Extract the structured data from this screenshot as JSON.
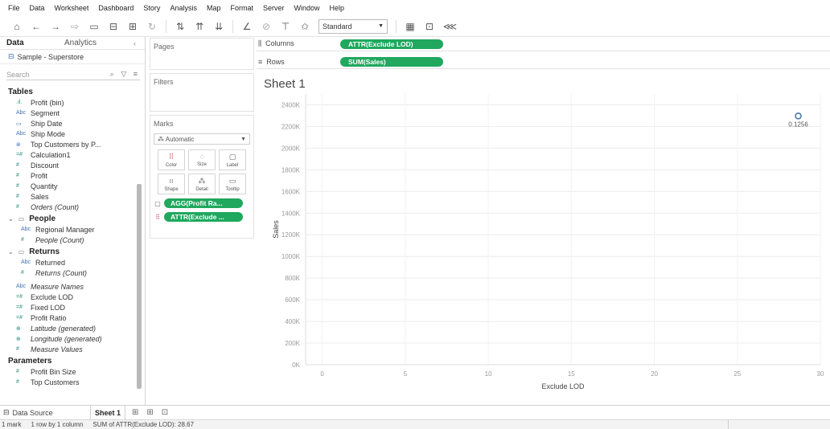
{
  "menu": [
    "File",
    "Data",
    "Worksheet",
    "Dashboard",
    "Story",
    "Analysis",
    "Map",
    "Format",
    "Server",
    "Window",
    "Help"
  ],
  "toolbar": {
    "fit_select": "Standard"
  },
  "data_pane": {
    "tab_data": "Data",
    "tab_analytics": "Analytics",
    "collapse_glyph": "‹",
    "source": "Sample - Superstore",
    "search_placeholder": "Search",
    "sections": {
      "tables": {
        "title": "Tables",
        "fields": [
          {
            "icon": ".ıl.",
            "label": "Profit (bin)",
            "italic": false
          },
          {
            "icon": "Abc",
            "label": "Segment",
            "italic": false
          },
          {
            "icon": "▭",
            "label": "Ship Date",
            "italic": false
          },
          {
            "icon": "Abc",
            "label": "Ship Mode",
            "italic": false
          },
          {
            "icon": "⊛",
            "label": "Top Customers by P...",
            "italic": false
          },
          {
            "icon": "=#",
            "label": "Calculation1",
            "italic": false
          },
          {
            "icon": "#",
            "label": "Discount",
            "italic": false
          },
          {
            "icon": "#",
            "label": "Profit",
            "italic": false
          },
          {
            "icon": "#",
            "label": "Quantity",
            "italic": false
          },
          {
            "icon": "#",
            "label": "Sales",
            "italic": false
          },
          {
            "icon": "#",
            "label": "Orders (Count)",
            "italic": true
          }
        ]
      },
      "people": {
        "title": "People",
        "fields": [
          {
            "icon": "Abc",
            "label": "Regional Manager",
            "italic": false
          },
          {
            "icon": "#",
            "label": "People (Count)",
            "italic": true
          }
        ]
      },
      "returns": {
        "title": "Returns",
        "fields": [
          {
            "icon": "Abc",
            "label": "Returned",
            "italic": false
          },
          {
            "icon": "#",
            "label": "Returns (Count)",
            "italic": true
          }
        ]
      },
      "loose": [
        {
          "icon": "Abc",
          "label": "Measure Names",
          "italic": true
        },
        {
          "icon": "=#",
          "label": "Exclude LOD",
          "italic": false
        },
        {
          "icon": "=#",
          "label": "Fixed LOD",
          "italic": false
        },
        {
          "icon": "=#",
          "label": "Profit Ratio",
          "italic": false
        },
        {
          "icon": "⊕",
          "label": "Latitude (generated)",
          "italic": true
        },
        {
          "icon": "⊕",
          "label": "Longitude (generated)",
          "italic": true
        },
        {
          "icon": "#",
          "label": "Measure Values",
          "italic": true
        }
      ],
      "parameters": {
        "title": "Parameters",
        "fields": [
          {
            "icon": "#",
            "label": "Profit Bin Size",
            "italic": false
          },
          {
            "icon": "#",
            "label": "Top Customers",
            "italic": false
          }
        ]
      }
    }
  },
  "cards": {
    "pages": "Pages",
    "filters": "Filters",
    "marks": "Marks",
    "mark_type": "Automatic",
    "mark_buttons": [
      {
        "glyph": "⠿",
        "label": "Color"
      },
      {
        "glyph": "◌",
        "label": "Size"
      },
      {
        "glyph": "▢",
        "label": "Label"
      },
      {
        "glyph": "⠶",
        "label": "Shape"
      },
      {
        "glyph": "⁂",
        "label": "Detail"
      },
      {
        "glyph": "▭",
        "label": "Tooltip"
      }
    ],
    "mark_pills": [
      {
        "icon": "▢",
        "label": "AGG(Profit Ra..."
      },
      {
        "icon": "⠿",
        "label": "ATTR(Exclude ..."
      }
    ]
  },
  "shelves": {
    "columns_label": "Columns",
    "columns_pill": "ATTR(Exclude LOD)",
    "rows_label": "Rows",
    "rows_pill": "SUM(Sales)"
  },
  "sheet": {
    "title": "Sheet 1"
  },
  "chart_data": {
    "type": "scatter",
    "xlabel": "Exclude LOD",
    "ylabel": "Sales",
    "xlim": [
      -1,
      30
    ],
    "ylim": [
      0,
      2500000
    ],
    "x_ticks": [
      0,
      5,
      10,
      15,
      20,
      25,
      30
    ],
    "y_ticks": [
      0,
      200000,
      400000,
      600000,
      800000,
      1000000,
      1200000,
      1400000,
      1600000,
      1800000,
      2000000,
      2200000,
      2400000
    ],
    "y_tick_labels": [
      "0K",
      "200K",
      "400K",
      "600K",
      "800K",
      "1000K",
      "1200K",
      "1400K",
      "1600K",
      "1800K",
      "2000K",
      "2200K",
      "2400K"
    ],
    "grid": true,
    "points": [
      {
        "x": 28.67,
        "y": 2297201,
        "label": "0.1256"
      }
    ]
  },
  "bottom_tabs": {
    "data_source": "Data Source",
    "sheet": "Sheet 1"
  },
  "status": {
    "marks": "1 mark",
    "dims": "1 row by 1 column",
    "sum": "SUM of ATTR(Exclude LOD): 28.67"
  }
}
